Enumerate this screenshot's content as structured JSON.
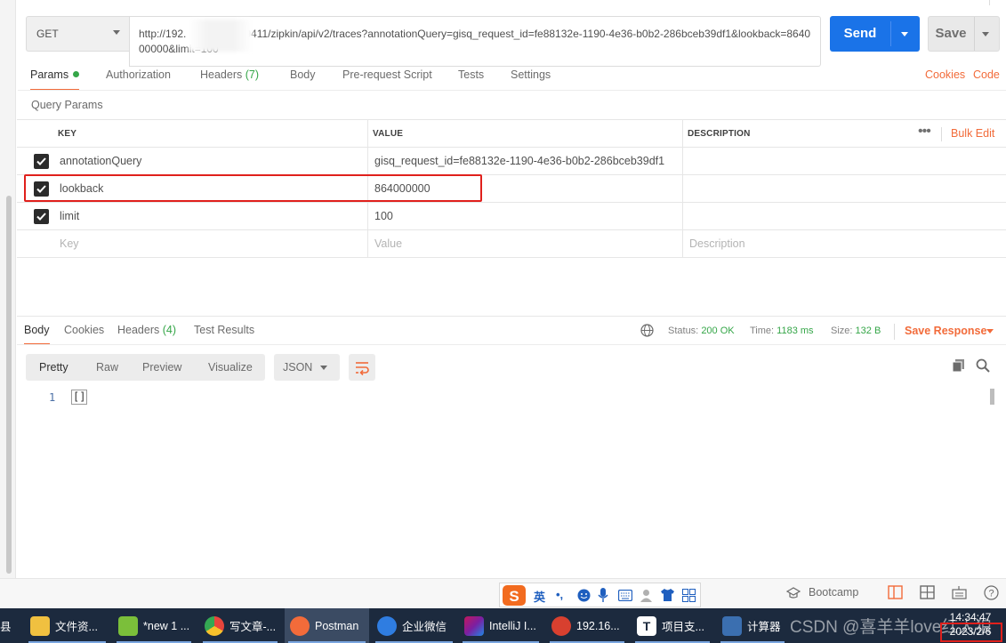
{
  "request": {
    "method": "GET",
    "url_part1": "http://192.",
    "url_part2": "9411/zipkin/api/v2/traces?annotationQuery=gisq_request_id=fe88132e-1190-4e36-b0b2-286bceb39df1&lookback=864000000&limit=100",
    "send_label": "Send",
    "save_label": "Save"
  },
  "request_tabs": [
    {
      "label": "Params",
      "count": ""
    },
    {
      "label": "Authorization",
      "count": ""
    },
    {
      "label": "Headers",
      "count": "(7)"
    },
    {
      "label": "Body",
      "count": ""
    },
    {
      "label": "Pre-request Script",
      "count": ""
    },
    {
      "label": "Tests",
      "count": ""
    },
    {
      "label": "Settings",
      "count": ""
    }
  ],
  "links": {
    "cookies": "Cookies",
    "code": "Code"
  },
  "query_params": {
    "title": "Query Params",
    "headers": {
      "key": "KEY",
      "value": "VALUE",
      "description": "DESCRIPTION"
    },
    "bulk_edit": "Bulk Edit",
    "more": "•••",
    "rows": [
      {
        "checked": true,
        "key": "annotationQuery",
        "value": "gisq_request_id=fe88132e-1190-4e36-b0b2-286bceb39df1",
        "description": ""
      },
      {
        "checked": true,
        "key": "lookback",
        "value": "864000000",
        "description": ""
      },
      {
        "checked": true,
        "key": "limit",
        "value": "100",
        "description": ""
      }
    ],
    "placeholders": {
      "key": "Key",
      "value": "Value",
      "description": "Description"
    }
  },
  "response": {
    "tabs": [
      {
        "label": "Body",
        "count": ""
      },
      {
        "label": "Cookies",
        "count": ""
      },
      {
        "label": "Headers",
        "count": "(4)"
      },
      {
        "label": "Test Results",
        "count": ""
      }
    ],
    "status_label": "Status:",
    "status_value": "200 OK",
    "time_label": "Time:",
    "time_value": "1183 ms",
    "size_label": "Size:",
    "size_value": "132 B",
    "save_response": "Save Response",
    "formats": [
      "Pretty",
      "Raw",
      "Preview",
      "Visualize"
    ],
    "language": "JSON",
    "line_number": "1",
    "body_text": "[]"
  },
  "ime": {
    "mode": "英",
    "punct": "•,"
  },
  "footer": {
    "bootcamp": "Bootcamp"
  },
  "taskbar": {
    "items": [
      {
        "label": "文件资...",
        "color": "#f0c040"
      },
      {
        "label": "*new 1 ...",
        "color": "#7bbf3a"
      },
      {
        "label": "写文章-...",
        "color": "#e8453c"
      },
      {
        "label": "Postman",
        "color": "#f26b3a"
      },
      {
        "label": "企业微信",
        "color": "#2f7de1"
      },
      {
        "label": "IntelliJ I...",
        "color": "#c2185b"
      },
      {
        "label": "192.16...",
        "color": "#d8402f"
      },
      {
        "label": "项目支...",
        "color": "#ffffff"
      },
      {
        "label": "计算器",
        "color": "#3b6fb0"
      }
    ],
    "left_fragment": "县",
    "watermark": "CSDN @喜羊羊love红太狼",
    "time": "14:34:47",
    "date": "2023/2/6"
  }
}
